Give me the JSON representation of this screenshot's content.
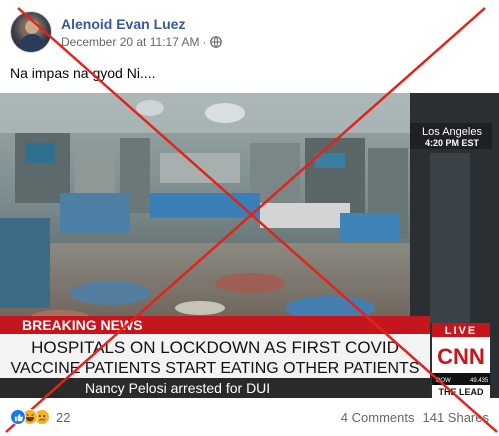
{
  "post": {
    "author": "Alenoid Evan Luez",
    "date": "December 20 at 11:17 AM",
    "separator": "·",
    "privacy_icon": "globe-icon",
    "text": "Na impas na gyod Ni...."
  },
  "media": {
    "location": "Los Angeles",
    "time": "4:20 PM EST",
    "breaking_label": "BREAKING NEWS",
    "headline_line1": "HOSPITALS ON LOCKDOWN AS FIRST COVID",
    "headline_line2": "VACCINE PATIENTS START EATING OTHER PATIENTS",
    "ticker": "Nancy Pelosi arrested for DUI",
    "live_badge": "LIVE",
    "network_logo": "CNN",
    "dow_label": "DOW",
    "dow_value": "49.435",
    "the_lead": "THE LEAD"
  },
  "footer": {
    "reaction_icons": [
      "like-icon",
      "haha-icon",
      "sad-icon"
    ],
    "reaction_count": "22",
    "comments": "4 Comments",
    "shares": "141 Shares"
  },
  "colors": {
    "author_link": "#385898",
    "secondary_text": "#65676b",
    "cross_red": "#e0241b",
    "breaking_red": "#c4161c"
  }
}
